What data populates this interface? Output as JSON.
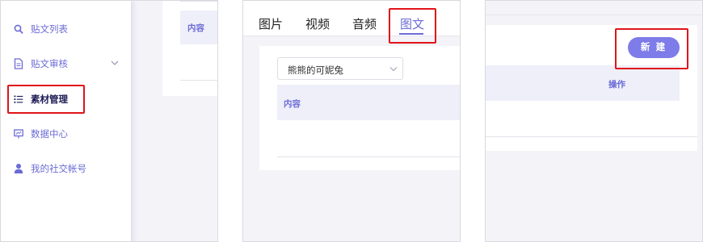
{
  "sidebar": {
    "items": [
      {
        "label": "贴文列表",
        "icon": "search-icon"
      },
      {
        "label": "贴文审核",
        "icon": "document-icon"
      },
      {
        "label": "素材管理",
        "icon": "list-icon"
      },
      {
        "label": "数据中心",
        "icon": "presentation-icon"
      },
      {
        "label": "我的社交帐号",
        "icon": "user-icon"
      }
    ],
    "active_index": 2
  },
  "panel1_table": {
    "header": "内容"
  },
  "tabs": [
    {
      "label": "图片"
    },
    {
      "label": "视频"
    },
    {
      "label": "音频"
    },
    {
      "label": "图文"
    }
  ],
  "active_tab_index": 3,
  "account_select": {
    "value": "熊熊的可妮兔"
  },
  "content_table": {
    "header": "内容"
  },
  "toolbar": {
    "new_label": "新 建"
  },
  "ops_table": {
    "header": "操作"
  },
  "colors": {
    "accent": "#6b6bd6",
    "button": "#7d7ce8",
    "highlight": "#e0141a",
    "table_header_bg": "#efeffa"
  }
}
